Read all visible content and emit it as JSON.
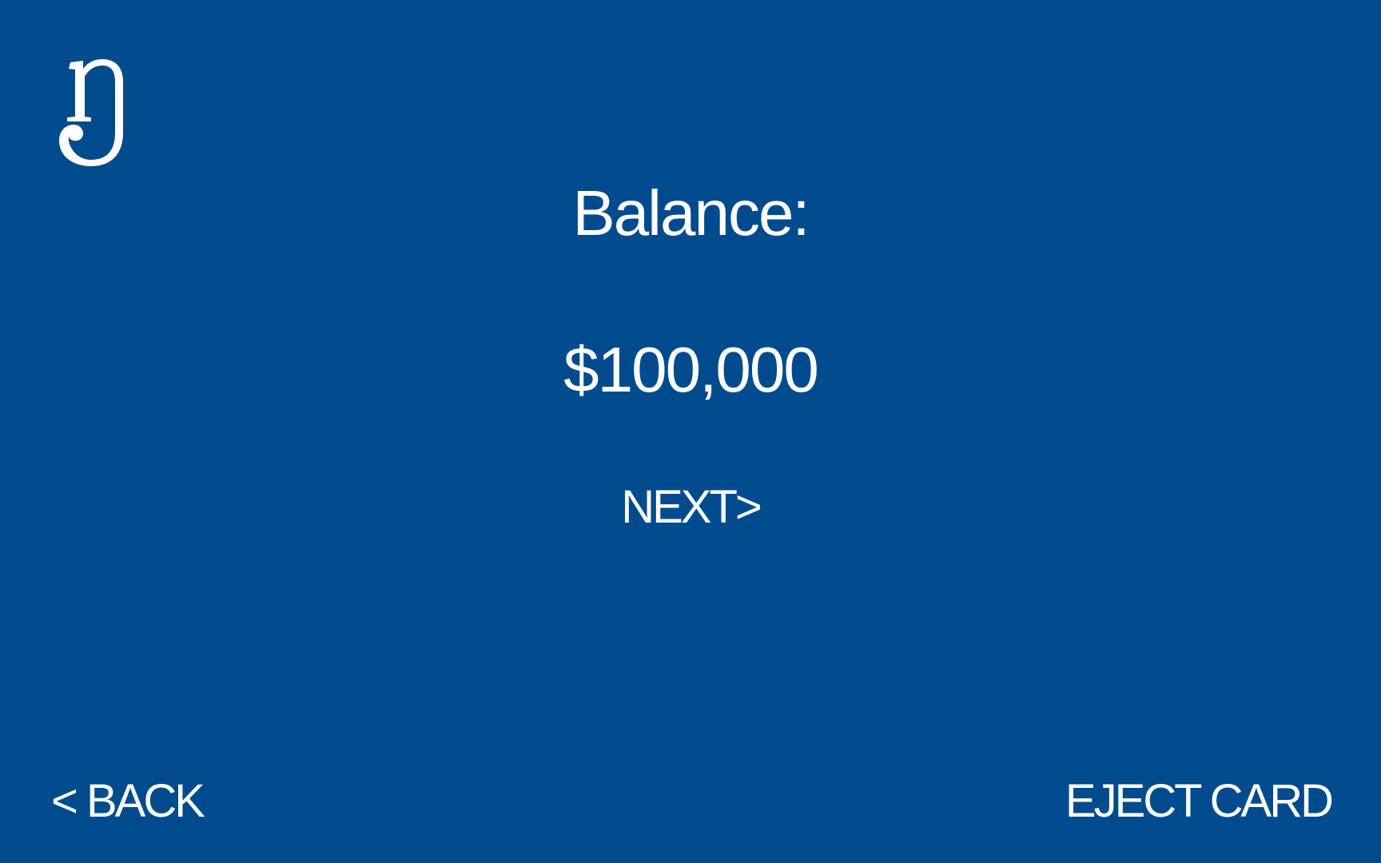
{
  "colors": {
    "background": "#004b8d",
    "foreground": "#ffffff"
  },
  "logo": {
    "icon": "bank-monogram-logo"
  },
  "balance": {
    "label": "Balance:",
    "amount": "$100,000"
  },
  "buttons": {
    "next_label": "NEXT>",
    "back_label": "< BACK",
    "eject_label": "EJECT CARD"
  }
}
